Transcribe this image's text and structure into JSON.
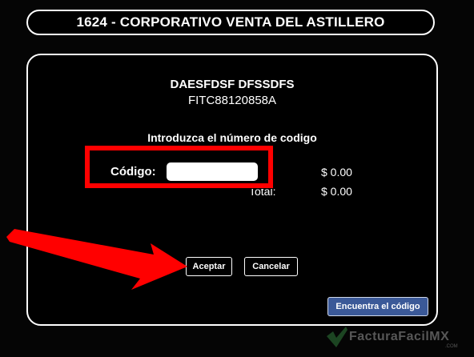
{
  "header": {
    "title": "1624 - CORPORATIVO VENTA DEL ASTILLERO"
  },
  "customer": {
    "name": "DAESFDSF DFSSDFS",
    "rfc": "FITC88120858A"
  },
  "form": {
    "prompt": "Introduzca el número de codigo",
    "code_label": "Código:",
    "code_value": ""
  },
  "amounts": {
    "first": "$ 0.00",
    "total_label": "Total:",
    "total": "$ 0.00"
  },
  "buttons": {
    "accept": "Aceptar",
    "cancel": "Cancelar",
    "find_code": "Encuentra el código"
  },
  "watermark": {
    "brand": "FacturaFacilMX",
    "suffix": ".COM"
  },
  "colors": {
    "highlight": "#ff0000",
    "find_button": "#3b5998",
    "background": "#000000"
  }
}
